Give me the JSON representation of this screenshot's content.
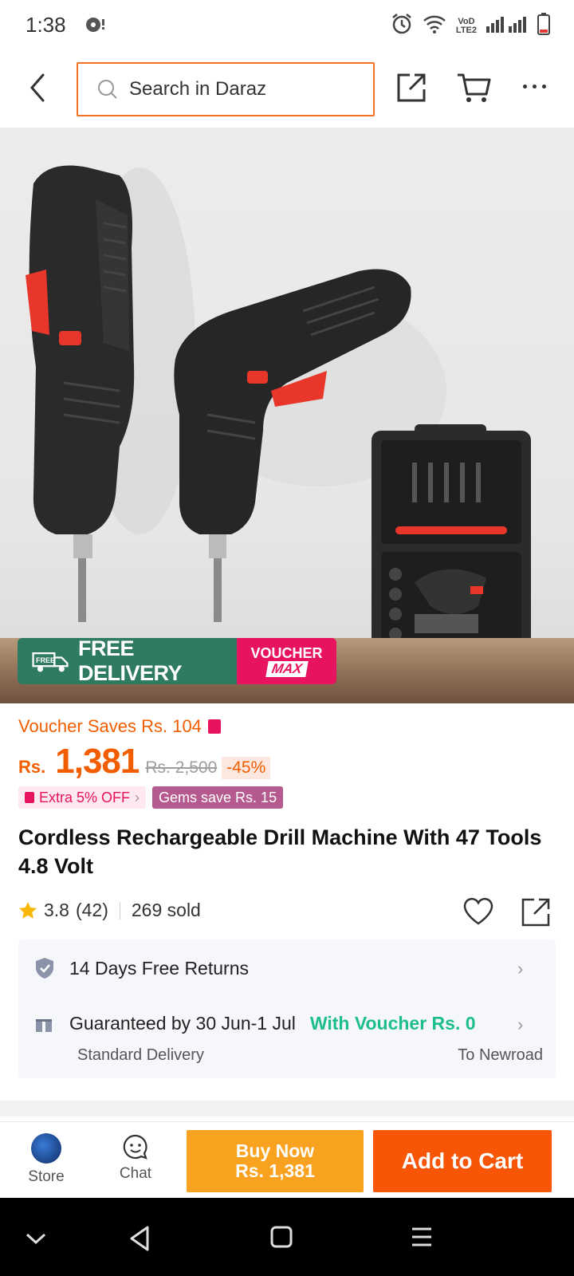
{
  "status_bar": {
    "time": "1:38",
    "network_label_top": "VoD",
    "network_label_bottom": "LTE2"
  },
  "header": {
    "search_placeholder": "Search in Daraz",
    "icons": [
      "back-icon",
      "search-icon",
      "share-icon",
      "cart-icon",
      "more-icon"
    ]
  },
  "hero": {
    "free_delivery_tag": "FREE",
    "free_delivery_label": "FREE DELIVERY",
    "voucher_label_top": "VOUCHER",
    "voucher_label_bottom": "MAX"
  },
  "product": {
    "voucher_saves": "Voucher Saves Rs. 104",
    "currency": "Rs.",
    "price": "1,381",
    "original_price": "Rs. 2,500",
    "discount": "-45%",
    "extra_off": "Extra 5% OFF",
    "gems_save": "Gems save Rs. 15",
    "title": "Cordless Rechargeable Drill Machine With 47 Tools 4.8 Volt",
    "rating": "3.8",
    "reviews": "(42)",
    "sold": "269 sold"
  },
  "services": {
    "returns": "14 Days Free Returns",
    "guarantee": "Guaranteed by 30 Jun-1 Jul",
    "voucher_delivery": "With Voucher Rs. 0",
    "delivery_type": "Standard Delivery",
    "delivery_to": "To Newroad"
  },
  "bottom_bar": {
    "store_label": "Store",
    "chat_label": "Chat",
    "buy_now_line1": "Buy Now",
    "buy_now_line2": "Rs. 1,381",
    "add_to_cart": "Add to Cart"
  },
  "colors": {
    "accent_orange": "#f85606",
    "price_orange": "#f25d00",
    "buy_now_yellow": "#f8a21f",
    "voucher_pink": "#e8135f",
    "free_delivery_green": "#2f7a63",
    "voucher_green_text": "#1dbe8a"
  }
}
